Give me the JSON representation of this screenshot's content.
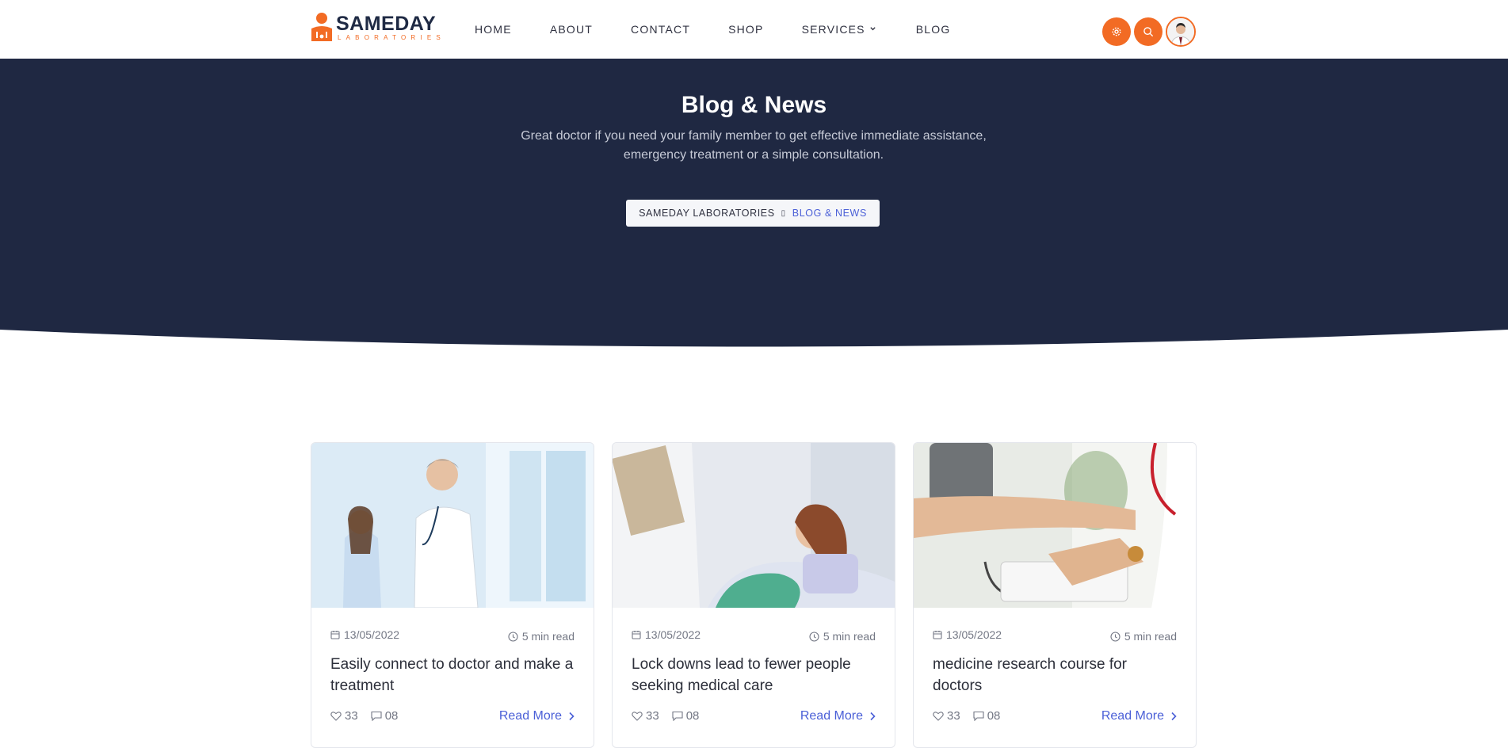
{
  "brand": {
    "name": "SAMEDAY",
    "tagline": "LABORATORIES"
  },
  "nav": {
    "items": [
      "HOME",
      "ABOUT",
      "CONTACT",
      "SHOP",
      "SERVICES",
      "BLOG"
    ]
  },
  "header_actions": {
    "settings_icon": "gear-icon",
    "search_icon": "search-icon",
    "avatar": "doctor-avatar"
  },
  "hero": {
    "title": "Blog & News",
    "subtitle": "Great doctor if you need your family member to get effective immediate assistance, emergency treatment or a simple consultation.",
    "breadcrumb": {
      "home": "SAMEDAY LABORATORIES",
      "current": "BLOG & NEWS"
    }
  },
  "posts": [
    {
      "date": "13/05/2022",
      "read_time": "5 min read",
      "title": "Easily connect to doctor and make a treatment",
      "likes": "33",
      "comments": "08",
      "read_more": "Read More",
      "image": "doctor-with-girl-patient"
    },
    {
      "date": "13/05/2022",
      "read_time": "5 min read",
      "title": "Lock downs lead to fewer people seeking medical care",
      "likes": "33",
      "comments": "08",
      "read_more": "Read More",
      "image": "woman-patient-in-bed"
    },
    {
      "date": "13/05/2022",
      "read_time": "5 min read",
      "title": "medicine research course for doctors",
      "likes": "33",
      "comments": "08",
      "read_more": "Read More",
      "image": "blood-pressure-check"
    }
  ],
  "colors": {
    "navy": "#1f2842",
    "accent": "#f26b24",
    "link": "#4a5fd7"
  }
}
